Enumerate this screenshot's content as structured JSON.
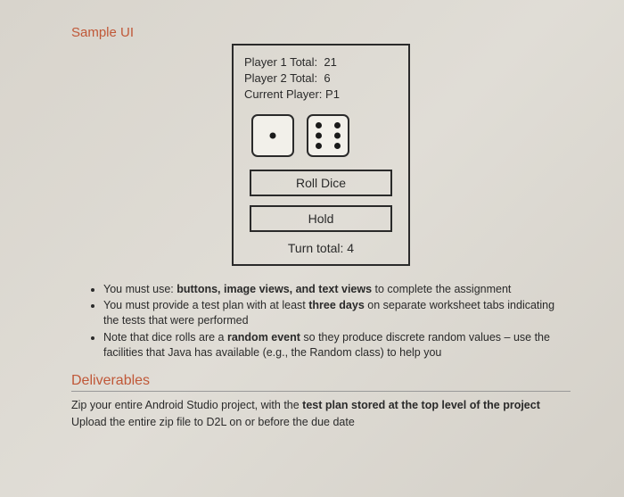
{
  "heading_sample_ui": "Sample UI",
  "game": {
    "p1_label": "Player 1 Total:",
    "p1_value": "21",
    "p2_label": "Player 2 Total:",
    "p2_value": "6",
    "current_label": "Current Player:",
    "current_value": "P1",
    "die_left": "die-1-icon",
    "die_right": "die-6-icon",
    "roll_label": "Roll Dice",
    "hold_label": "Hold",
    "turn_total_label": "Turn total:",
    "turn_total_value": "4"
  },
  "bullets": [
    {
      "pre": "You must use: ",
      "bold": "buttons, image views, and text views",
      "post": " to complete the assignment"
    },
    {
      "pre": "You must provide a test plan with at least ",
      "bold": "three days",
      "post": " on separate worksheet tabs indicating the tests that were performed"
    },
    {
      "pre": "Note that dice rolls are a ",
      "bold": "random event",
      "post": " so they produce discrete random values – use the facilities that Java has available (e.g., the Random class) to help you"
    }
  ],
  "deliverables": {
    "title": "Deliverables",
    "line1_pre": "Zip your entire Android Studio project, with the ",
    "line1_bold": "test plan stored at the top level of the project",
    "line2": "Upload the entire zip file to D2L on or before the due date"
  }
}
